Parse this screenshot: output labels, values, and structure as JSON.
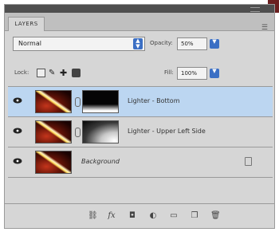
{
  "panel": {
    "tab_label": "LAYERS",
    "menu_icon": "panel-menu-icon"
  },
  "controls": {
    "blend_mode": "Normal",
    "opacity_label": "Opacity:",
    "opacity_value": "50%",
    "lock_label": "Lock:",
    "fill_label": "Fill:",
    "fill_value": "100%"
  },
  "layers": [
    {
      "name": "Lighter - Bottom",
      "selected": true,
      "visible": true,
      "has_mask": true
    },
    {
      "name": "Lighter - Upper Left Side",
      "selected": false,
      "visible": true,
      "has_mask": true
    },
    {
      "name": "Background",
      "selected": false,
      "visible": true,
      "has_mask": false,
      "locked": true
    }
  ],
  "footer_icons": [
    "link-layers-icon",
    "layer-style-icon",
    "add-mask-icon",
    "adjustment-layer-icon",
    "group-folder-icon",
    "new-layer-icon",
    "trash-icon"
  ],
  "colors": {
    "selection": "#bcd6f1",
    "spin_blue": "#3b6fc4",
    "panel_bg": "#d6d6d6",
    "titlebar": "#4f4f4f"
  }
}
